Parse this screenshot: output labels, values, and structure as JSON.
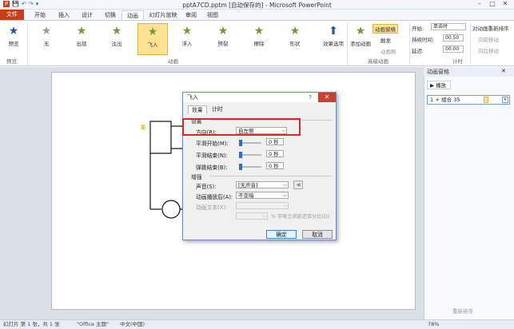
{
  "window": {
    "title": "pptA7CD.pptm [自动保存的] - Microsoft PowerPoint",
    "controls": [
      "–",
      "□",
      "✕"
    ]
  },
  "quick_access": [
    "P",
    "💾",
    "↶",
    "↷",
    "▾"
  ],
  "tabs": {
    "file": "文件",
    "items": [
      "开始",
      "插入",
      "设计",
      "切换",
      "动画",
      "幻灯片放映",
      "审阅",
      "视图"
    ],
    "active": "动画"
  },
  "ribbon": {
    "preview": {
      "label": "预览",
      "group": "预览"
    },
    "effects": [
      {
        "label": "无"
      },
      {
        "label": "出现"
      },
      {
        "label": "淡出"
      },
      {
        "label": "飞入"
      },
      {
        "label": "浮入"
      },
      {
        "label": "劈裂"
      },
      {
        "label": "擦除"
      },
      {
        "label": "形状"
      }
    ],
    "effect_options": "效果选项",
    "group_animation": "动画",
    "add_animation": "添加动画",
    "anim_pane": "动画窗格",
    "trigger": "触发",
    "anim_painter": "动画刷",
    "group_advanced": "高级动画",
    "start_label": "开始:",
    "start_value": "单击时",
    "duration_label": "持续时间:",
    "duration_value": "00.50",
    "delay_label": "延迟:",
    "delay_value": "00.00",
    "reorder_title": "对动画重新排序",
    "move_earlier": "向前移动",
    "move_later": "向后移动",
    "group_timing": "计时"
  },
  "pane": {
    "title": "动画窗格",
    "play": "播放",
    "item_num": "1",
    "item_label": "组合 35",
    "reorder": "重新排序"
  },
  "dialog": {
    "title": "飞入",
    "help": "?",
    "close": "✕",
    "tab_effect": "效果",
    "tab_timing": "计时",
    "sec_settings": "设置",
    "direction_label": "方向(R):",
    "direction_value": "自左侧",
    "smooth_start_label": "平滑开始(M):",
    "smooth_start_value": "0 秒",
    "smooth_end_label": "平滑结束(N):",
    "smooth_end_value": "0 秒",
    "bounce_end_label": "弹跳结束(B):",
    "bounce_end_value": "0 秒",
    "sec_enhance": "增强",
    "sound_label": "声音(S):",
    "sound_value": "[无声音]",
    "after_label": "动画播放后(A):",
    "after_value": "不变暗",
    "text_label": "动画文本(X):",
    "text_pct": "% 字母之间延迟百分比(D)",
    "ok": "确定",
    "cancel": "取消"
  },
  "slide": {
    "anim_marker": "1"
  },
  "status": {
    "slide": "幻灯片 第 1 张，共 1 张",
    "theme": "\"Office 主题\"",
    "lang": "中文(中国)",
    "zoom": "78%"
  },
  "colors": {
    "accent": "#2b579a",
    "file_tab": "#c43e1c",
    "highlight": "#fde294",
    "red_box": "#d8262d",
    "close": "#c84031"
  }
}
